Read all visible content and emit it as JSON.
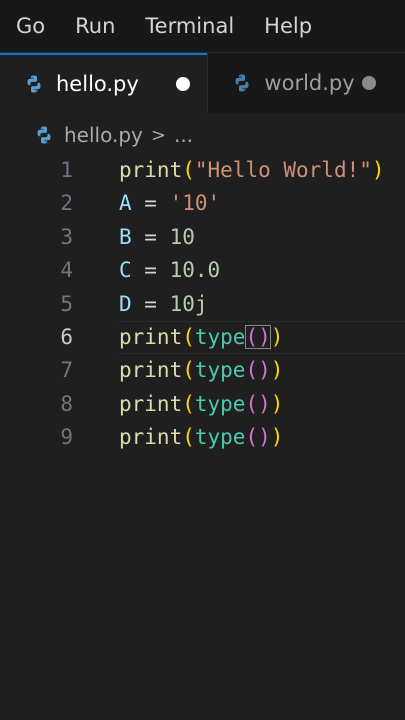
{
  "menubar": {
    "items": [
      "Go",
      "Run",
      "Terminal",
      "Help"
    ]
  },
  "tabs": [
    {
      "label": "hello.py",
      "icon": "python-file-icon",
      "state": "unsaved",
      "active": true
    },
    {
      "label": "world.py",
      "icon": "python-file-icon",
      "state": "unsaved",
      "active": false
    }
  ],
  "breadcrumb": {
    "file": "hello.py",
    "separator": ">",
    "more": "..."
  },
  "editor": {
    "current_line": 6,
    "lines": [
      {
        "num": "1",
        "tokens": [
          {
            "t": "print",
            "c": "fn"
          },
          {
            "t": "(",
            "c": "paren1"
          },
          {
            "t": "\"Hello World!\"",
            "c": "str"
          },
          {
            "t": ")",
            "c": "paren1"
          }
        ]
      },
      {
        "num": "2",
        "tokens": [
          {
            "t": "A",
            "c": "var"
          },
          {
            "t": " = ",
            "c": "op"
          },
          {
            "t": "'10'",
            "c": "str"
          }
        ]
      },
      {
        "num": "3",
        "tokens": [
          {
            "t": "B",
            "c": "var"
          },
          {
            "t": " = ",
            "c": "op"
          },
          {
            "t": "10",
            "c": "num"
          }
        ]
      },
      {
        "num": "4",
        "tokens": [
          {
            "t": "C",
            "c": "var"
          },
          {
            "t": " = ",
            "c": "op"
          },
          {
            "t": "10.0",
            "c": "num"
          }
        ]
      },
      {
        "num": "5",
        "tokens": [
          {
            "t": "D",
            "c": "var"
          },
          {
            "t": " = ",
            "c": "op"
          },
          {
            "t": "10j",
            "c": "num"
          }
        ]
      },
      {
        "num": "6",
        "tokens": [
          {
            "t": "print",
            "c": "fn"
          },
          {
            "t": "(",
            "c": "paren1"
          },
          {
            "t": "type",
            "c": "builtin"
          },
          {
            "t": "()",
            "c": "paren2 bracket-hl"
          },
          {
            "t": ")",
            "c": "paren1"
          }
        ]
      },
      {
        "num": "7",
        "tokens": [
          {
            "t": "print",
            "c": "fn"
          },
          {
            "t": "(",
            "c": "paren1"
          },
          {
            "t": "type",
            "c": "builtin"
          },
          {
            "t": "()",
            "c": "paren2"
          },
          {
            "t": ")",
            "c": "paren1"
          }
        ]
      },
      {
        "num": "8",
        "tokens": [
          {
            "t": "print",
            "c": "fn"
          },
          {
            "t": "(",
            "c": "paren1"
          },
          {
            "t": "type",
            "c": "builtin"
          },
          {
            "t": "()",
            "c": "paren2"
          },
          {
            "t": ")",
            "c": "paren1"
          }
        ]
      },
      {
        "num": "9",
        "tokens": [
          {
            "t": "print",
            "c": "fn"
          },
          {
            "t": "(",
            "c": "paren1"
          },
          {
            "t": "type",
            "c": "builtin"
          },
          {
            "t": "()",
            "c": "paren2"
          },
          {
            "t": ")",
            "c": "paren1"
          }
        ]
      }
    ]
  },
  "colors": {
    "accent": "#0078d4",
    "editor_bg": "#1f1f1f",
    "chrome_bg": "#181818"
  }
}
